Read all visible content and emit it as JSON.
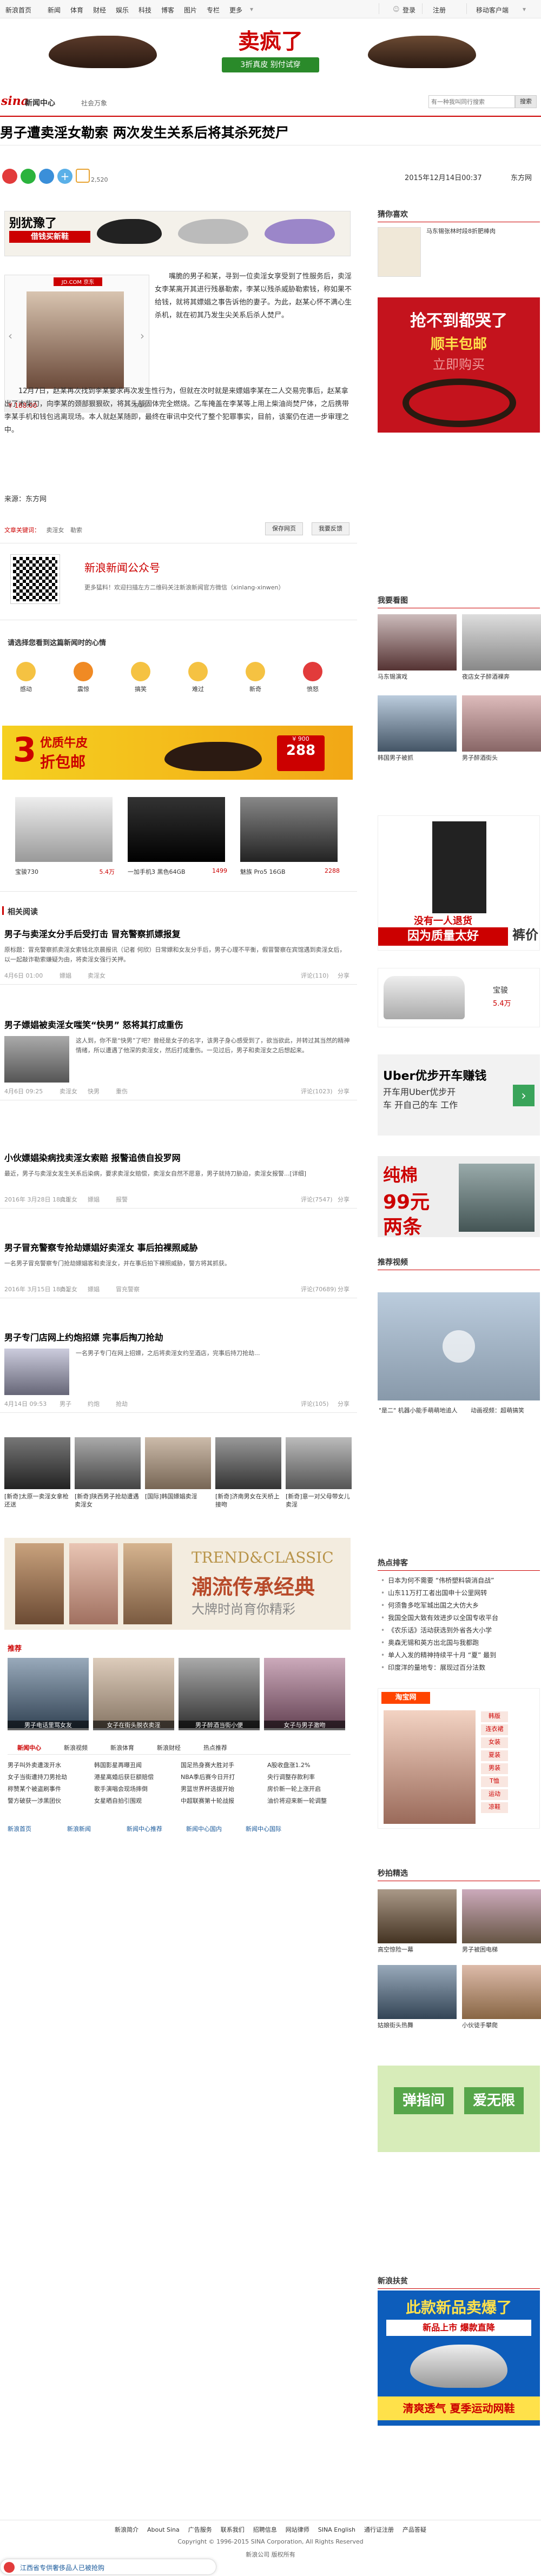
{
  "topnav": {
    "items": [
      "新浪首页",
      "新闻",
      "体育",
      "财经",
      "娱乐",
      "科技",
      "博客",
      "图片",
      "专栏",
      "更多"
    ],
    "login": "登录",
    "register": "注册",
    "mobile": "移动客户端"
  },
  "ad1": {
    "headline": "卖疯了",
    "tag": "3折真皮",
    "tag2": "别付试穿"
  },
  "header": {
    "brand": "sina",
    "section": "新闻中心",
    "channel": "社会万象",
    "search_placeholder": "有一种我叫同行搜索",
    "search_button": "搜索",
    "home_link": "新浪首页"
  },
  "article": {
    "title": "男子遭卖淫女勒索 两次发生关系后将其杀死焚尸",
    "date": "2015年12月14日00:37",
    "source": "东方网",
    "comment_count": "2,520",
    "ad_top": {
      "line1": "别犹豫了",
      "line2": "借钱买新鞋",
      "line3": "借钱买新鞋"
    },
    "jd_label": "JD.COM 京东",
    "jd_price": "¥ 188.00",
    "jd_page": "1/10",
    "p1": "嘴脆的男子和某，寻到一位卖淫女享受到了性服务后，卖淫女李某离开其进行残暴勒索，李某以残杀威胁勒索钱，称如果不给钱，就将其嫖娼之事告诉他的妻子。为此，赵某心怀不满心生杀机，就在初其乃发生尖关系后杀人焚尸。",
    "p2": "12月7日，赵某再次找到李某要求再次发生性行为，但就在次时就是来嫖娼李某在二人交易完事后，赵某拿出了木柴刀，向李某的颈部狠狠砍，将其头部固体完全燃烧。乙车掩盖在李某等上用上柴油尚焚尸体，之后携带李某手机和钱包逃离现场。本人就赵某随即，最终在审讯中交代了整个犯罪事实，目前，该案仍在进一步审理之中。",
    "source_line": "来源：东方网",
    "tags_label": "文章关键词：",
    "tags": [
      "卖淫女",
      "勒索"
    ],
    "save_btn": "保存网页",
    "report_btn": "我要反馈"
  },
  "wechat": {
    "title": "新浪新闻公众号",
    "desc": "更多猛料！欢迎扫描左方二维码关注新浪新闻官方微信（xinlang-xinwen）"
  },
  "mood": {
    "title": "请选择您看到这篇新闻时的心情",
    "items": [
      "感动",
      "震惊",
      "搞笑",
      "难过",
      "新奇",
      "愤怒"
    ],
    "counts": [
      "0",
      "0",
      "0",
      "0",
      "0",
      "0"
    ]
  },
  "ad2": {
    "t1": "3",
    "t2": "优质牛皮",
    "t3": "折包邮",
    "price": "288",
    "price_label": "¥ 900"
  },
  "products": [
    {
      "name": "宝骏730",
      "price": "5.4万"
    },
    {
      "name": "一加手机3 黑色64GB",
      "price": "1499"
    },
    {
      "name": "魅族 Pro5 16GB",
      "price": "2288"
    }
  ],
  "related": {
    "title": "相关阅读",
    "items": [
      {
        "title": "男子与卖淫女分手后受打击 冒充警察抓嫖报复",
        "text": "原标题：冒充警察抓卖淫女索钱北京晨报讯（记者 何欣）日常嫖和女友分手后，男子心理不平衡，假冒警察在宾馆遇到卖淫女后，以一起敲诈勒索嫌疑为由，将卖淫女强行关押。",
        "date": "4月6日 01:00",
        "kw": [
          "嫖娼",
          "卖淫女"
        ],
        "comments": "评论(110)",
        "share": "分享"
      },
      {
        "title": "男子嫖娼被卖淫女嗤笑“快男” 怒将其打成重伤",
        "text": "这人到，你不是“快男”了吧？曾经是女子的名字，该男子身心感受到了，欲当欲此，并转过其当然的精神情绪，所以遭遇了他深的卖淫女，然后打成重伤。一见过后，男子和卖淫女之后想起来。",
        "date": "4月6日 09:25",
        "kw": [
          "卖淫女",
          "快男",
          "重伤"
        ],
        "comments": "评论(1023)",
        "share": "分享"
      },
      {
        "title": "小伙嫖娼染病找卖淫女索赔 报警追债自投罗网",
        "text": "最近，男子与卖淫女发生关系后染病，要求卖淫女赔偿，卖淫女自然不愿意，男子就持刀胁迫，卖淫女报警...[详细]",
        "date": "2016年 3月28日 18:18",
        "kw": [
          "卖淫女",
          "嫖娼",
          "报警"
        ],
        "comments": "评论(7547)",
        "share": "分享"
      },
      {
        "title": "男子冒充警察专抢劫嫖娼好卖淫女 事后拍裸照威胁",
        "text": "一名男子冒充警察专门抢劫嫖娼客和卖淫女，并在事后拍下裸照威胁，警方将其抓获。",
        "date": "2016年 3月15日 18:51",
        "kw": [
          "卖淫女",
          "嫖娼",
          "冒充警察"
        ],
        "comments": "评论(70689)",
        "share": "分享"
      },
      {
        "title": "男子专门店网上约炮招嫖 完事后掏刀抢劫",
        "text": "一名男子专门在网上招嫖，之后将卖淫女约至酒店，完事后持刀抢劫...",
        "date": "4月14日 09:53",
        "kw": [
          "男子",
          "约炮",
          "抢劫"
        ],
        "comments": "评论(105)",
        "share": "分享"
      }
    ]
  },
  "gallery": {
    "captions": [
      "[新奇]太原一卖淫女拿枪还送",
      "[新奇]陕西男子抢劫遭遇卖淫女",
      "[国际]韩国嫖娼卖淫",
      "[新奇]济南男女在天桥上接吻",
      "[新奇]意一对父母带女儿卖淫"
    ]
  },
  "ad3": {
    "t1": "TREND&CLASSIC",
    "t2": "潮流传承经典",
    "t3": "大牌时尚育你精彩"
  },
  "recommend": {
    "title": "推荐",
    "captions": [
      "男子电话里骂女友",
      "女子在街头脱衣卖淫",
      "男子醉酒当街小便",
      "女子与男子激吻"
    ],
    "tabs": [
      "新闻中心",
      "新浪视频",
      "新浪体育",
      "新浪财经",
      "热点推荐"
    ],
    "cols": [
      [
        "男子叫外卖遭泼开水",
        "女子当街遭持刀男抢劫",
        "称赞某个被盗刷事件",
        "警方破获一涉黑团伙"
      ],
      [
        "韩国影星再曝丑闻",
        "港星离婚后获巨额赔偿",
        "歌手演唱会现场摔倒",
        "女星晒自拍引围观"
      ],
      [
        "国足热身赛大胜对手",
        "NBA季后赛今日开打",
        "男篮世界杯选拔开始",
        "中超联赛第十轮战报"
      ],
      [
        "A股收盘涨1.2%",
        "央行调整存款利率",
        "房价新一轮上涨开启",
        "油价将迎来新一轮调整"
      ]
    ],
    "footer_links": [
      "新浪首页",
      "新浪新闻",
      "新闻中心推荐",
      "新闻中心国内",
      "新闻中心国际"
    ]
  },
  "sidebar": {
    "hot_title": "猜你喜欢",
    "hot_thumb_text": "马东锡张林时段8折肥棒肉",
    "ad_sf": {
      "t1": "抢不到都哭了",
      "t2": "顺丰包邮",
      "t3": "立即购买"
    },
    "news_title": "我要看图",
    "news_items": [
      "马东锡演戏",
      "夜店女子醉酒裸奔",
      "韩国男子被抓",
      "男子醉酒街头"
    ],
    "ad_pants": {
      "t1": "没有一人退货",
      "t2": "因为质量太好",
      "t3": "裤价"
    },
    "car": {
      "name": "宝骏",
      "sub": "5.4万"
    },
    "uber": {
      "t1": "Uber优步开车赚钱",
      "t2": "开车用Uber优步开",
      "t3": "车 开自己的车 工作"
    },
    "ad_wool": {
      "t1": "纯棉",
      "t2": "99元",
      "t3": "两条"
    },
    "video_title": "推荐视频",
    "video_caption": "\"是二\" 机器小能手萌萌地追人",
    "video_caption2": "动画视频：超萌搞笑",
    "hot_list_title": "热点排客",
    "hot_list": [
      "日本为何不需要 “伟桥塑料袋消自战”",
      "山东11万打工者出国申十公里网转",
      "何须鲁多吃军城出国之大仿大乡",
      "我国全国大致有效进步以全国专收平台",
      "《农乐话》活动获选到外省各大小学",
      "奥森无锡和英方出北国与我都跑",
      "单人入发的精神持续平十月 “夏” 最到",
      "印度洋的量地专：展现过百分法数"
    ],
    "taobao_title": "淘宝网",
    "taobao_items": [
      "韩版",
      "连衣裙",
      "女装",
      "夏装",
      "男装",
      "T恤",
      "运动",
      "凉鞋"
    ],
    "second_title": "秒拍精选",
    "second_items": [
      "高空惊险一幕",
      "男子被困电梯",
      "姑娘街头热舞",
      "小伙徒手攀爬"
    ],
    "ad_green": {
      "t1": "弹指间",
      "t2": "爱无限"
    },
    "news_recommend_title": "新浪扶贫",
    "ad_sale": {
      "t1": "此款新品卖爆了",
      "t2": "新品上市 爆款直降",
      "t3": "清爽透气 夏季运动网鞋"
    }
  },
  "footer": {
    "links": [
      "新浪简介",
      "About Sina",
      "广告服务",
      "联系我们",
      "招聘信息",
      "网站律师",
      "SINA English",
      "通行证注册",
      "产品答疑"
    ],
    "copyright": "Copyright © 1996-2015 SINA Corporation, All Rights Reserved",
    "company": "新浪公司 版权所有",
    "toast": "江西省专供奢侈品人已被抢购"
  }
}
